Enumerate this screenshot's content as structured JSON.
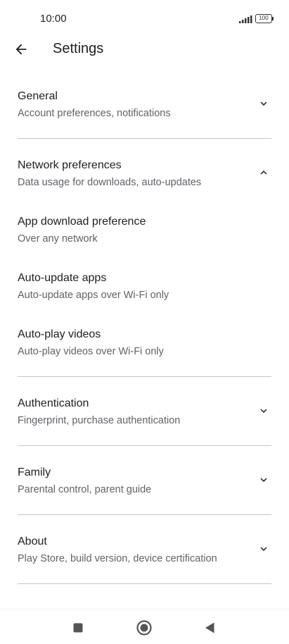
{
  "status": {
    "time": "10:00",
    "battery": "100"
  },
  "header": {
    "title": "Settings"
  },
  "sections": [
    {
      "title": "General",
      "subtitle": "Account preferences, notifications",
      "expanded": false
    },
    {
      "title": "Network preferences",
      "subtitle": "Data usage for downloads, auto-updates",
      "expanded": true,
      "items": [
        {
          "title": "App download preference",
          "subtitle": "Over any network"
        },
        {
          "title": "Auto-update apps",
          "subtitle": "Auto-update apps over Wi-Fi only"
        },
        {
          "title": "Auto-play videos",
          "subtitle": "Auto-play videos over Wi-Fi only"
        }
      ]
    },
    {
      "title": "Authentication",
      "subtitle": "Fingerprint, purchase authentication",
      "expanded": false
    },
    {
      "title": "Family",
      "subtitle": "Parental control, parent guide",
      "expanded": false
    },
    {
      "title": "About",
      "subtitle": "Play Store, build version, device certification",
      "expanded": false
    }
  ],
  "icons": {
    "back": "arrow-left-icon",
    "expand": "chevron-down-icon",
    "collapse": "chevron-up-icon",
    "nav_recents": "square-icon",
    "nav_home": "circle-icon",
    "nav_back": "triangle-back-icon"
  },
  "colors": {
    "text_primary": "#202124",
    "text_secondary": "#5f6368",
    "divider": "#c4c7c5"
  }
}
